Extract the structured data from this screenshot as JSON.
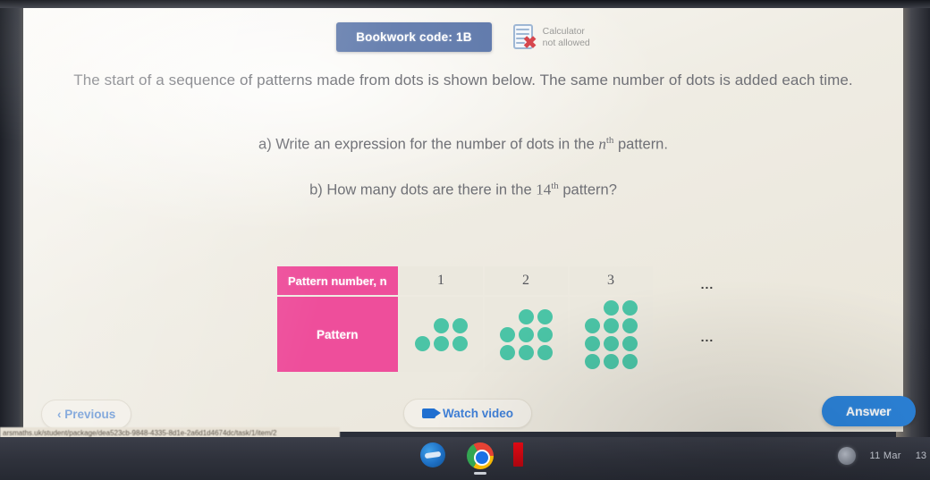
{
  "header": {
    "bookwork_code": "Bookwork code: 1B",
    "calculator_line1": "Calculator",
    "calculator_line2": "not allowed"
  },
  "question": {
    "intro": "The start of a sequence of patterns made from dots is shown below. The same number of dots is added each time.",
    "part_a_prefix": "a) Write an expression for the number of dots in the ",
    "part_a_var": "n",
    "part_a_sup": "th",
    "part_a_suffix": " pattern.",
    "part_b_prefix": "b) How many dots are there in the ",
    "part_b_num": "14",
    "part_b_sup": "th",
    "part_b_suffix": " pattern?"
  },
  "table": {
    "row_header_1": "Pattern number, n",
    "row_header_2": "Pattern",
    "pattern_numbers": [
      "1",
      "2",
      "3"
    ],
    "ellipsis": "...",
    "dot_color": "#4bc4a6",
    "header_color": "#ee4e9b",
    "cell_color": "#ebe8de",
    "patterns": [
      {
        "n": 1,
        "total_dots": 5,
        "rows": [
          [
            0,
            1,
            1
          ],
          [
            1,
            1,
            1
          ]
        ]
      },
      {
        "n": 2,
        "total_dots": 8,
        "rows": [
          [
            0,
            1,
            1
          ],
          [
            1,
            1,
            1
          ],
          [
            1,
            1,
            1
          ]
        ]
      },
      {
        "n": 3,
        "total_dots": 11,
        "rows": [
          [
            0,
            1,
            1
          ],
          [
            1,
            1,
            1
          ],
          [
            1,
            1,
            1
          ],
          [
            1,
            1,
            1
          ]
        ]
      }
    ]
  },
  "toolbar": {
    "previous_label": "Previous",
    "previous_chevron": "‹",
    "watch_video_label": "Watch video",
    "answer_label": "Answer"
  },
  "browser": {
    "status_url": "arsmaths.uk/student/package/dea523cb-9848-4335-8d1e-2a6d1d4674dc/task/1/item/2"
  },
  "taskbar": {
    "apps": [
      "edge-icon",
      "chrome-icon",
      "netflix-icon"
    ],
    "weather_icon": "moon-icon",
    "date": "11 Mar",
    "extra": "13"
  }
}
